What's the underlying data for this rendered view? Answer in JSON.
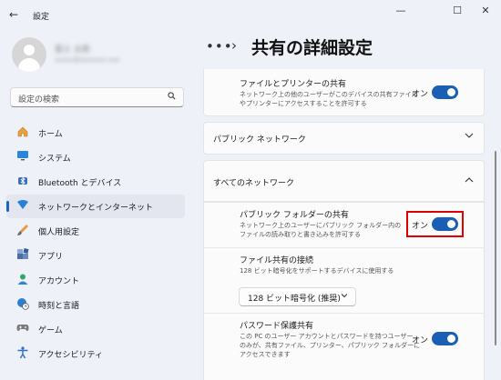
{
  "window": {
    "title": "設定",
    "minimize": "—",
    "maximize": "☐",
    "close": "✕"
  },
  "profile": {
    "name": "富士 太郎",
    "email": "xxxxx@xxxxxxx.xxx"
  },
  "search": {
    "placeholder": "設定の検索"
  },
  "sidebar": {
    "items": [
      {
        "label": "ホーム",
        "icon": "home-icon"
      },
      {
        "label": "システム",
        "icon": "monitor-icon"
      },
      {
        "label": "Bluetooth とデバイス",
        "icon": "bluetooth-icon"
      },
      {
        "label": "ネットワークとインターネット",
        "icon": "wifi-icon",
        "active": true
      },
      {
        "label": "個人用設定",
        "icon": "paintbrush-icon"
      },
      {
        "label": "アプリ",
        "icon": "apps-icon"
      },
      {
        "label": "アカウント",
        "icon": "person-icon"
      },
      {
        "label": "時刻と言語",
        "icon": "clock-globe-icon"
      },
      {
        "label": "ゲーム",
        "icon": "gamepad-icon"
      },
      {
        "label": "アクセシビリティ",
        "icon": "accessibility-icon"
      }
    ]
  },
  "header": {
    "dots": "•••",
    "chevron": "›",
    "title": "共有の詳細設定"
  },
  "main": {
    "file_printer": {
      "title": "ファイルとプリンターの共有",
      "desc1": "ネットワーク上の他のユーザーがこのデバイスの共有ファイル",
      "desc2": "やプリンターにアクセスすることを許可する",
      "state": "オン"
    },
    "public_network": {
      "title": "パブリック ネットワーク"
    },
    "all_networks": {
      "title": "すべてのネットワーク"
    },
    "public_folder": {
      "title": "パブリック フォルダーの共有",
      "desc1": "ネットワーク上のユーザーにパブリック フォルダー内の",
      "desc2": "ファイルの読み取りと書き込みを許可する",
      "state": "オン"
    },
    "file_sharing_conn": {
      "title": "ファイル共有の接続",
      "desc": "128 ビット暗号化をサポートするデバイスに使用する",
      "selected": "128 ビット暗号化 (推奨)"
    },
    "password_protected": {
      "title": "パスワード保護共有",
      "desc1": "この PC のユーザー アカウントとパスワードを持つユーザー",
      "desc2": "のみが、共有ファイル、プリンター、パブリック フォルダーに",
      "desc3": "アクセスできます",
      "state": "オン"
    }
  },
  "colors": {
    "accent": "#1a5fb4",
    "highlight": "#e00000"
  }
}
